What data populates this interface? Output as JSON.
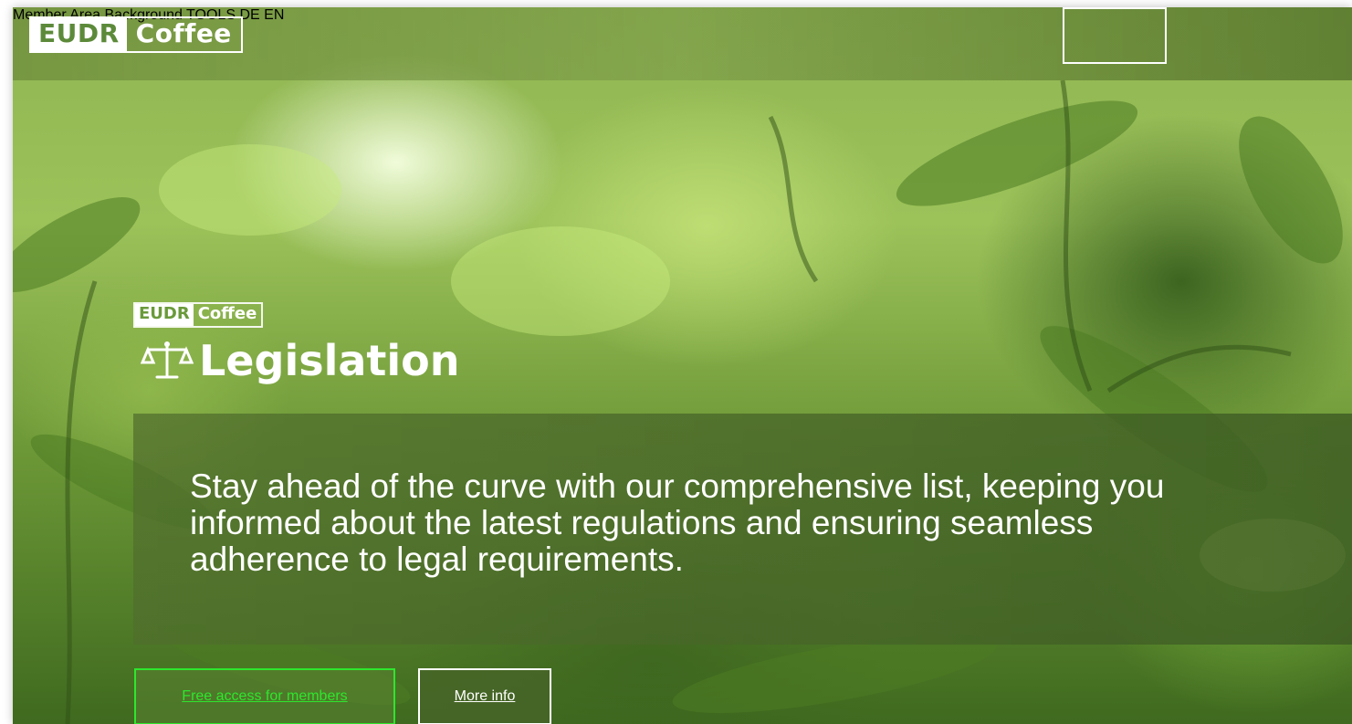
{
  "header": {
    "logo": {
      "part1": "EUDR",
      "part2": "Coffee"
    },
    "nav": [
      {
        "label": "Member Area"
      },
      {
        "label": "Background"
      },
      {
        "label": "TOOLS"
      },
      {
        "label": "DE"
      },
      {
        "label": "EN"
      }
    ]
  },
  "hero": {
    "mini_logo": {
      "part1": "EUDR",
      "part2": "Coffee"
    },
    "title": "Legislation",
    "title_icon": "scale-icon",
    "description": "Stay ahead of the curve with our comprehensive list, keeping you informed about the latest regulations and ensuring seamless adherence to legal requirements.",
    "buttons": {
      "free_access": "Free access for members",
      "more_info": "More info"
    }
  },
  "colors": {
    "brand_green": "#5c8a3a",
    "accent_bright_green": "#2ee62e",
    "text_white": "#ffffff"
  }
}
